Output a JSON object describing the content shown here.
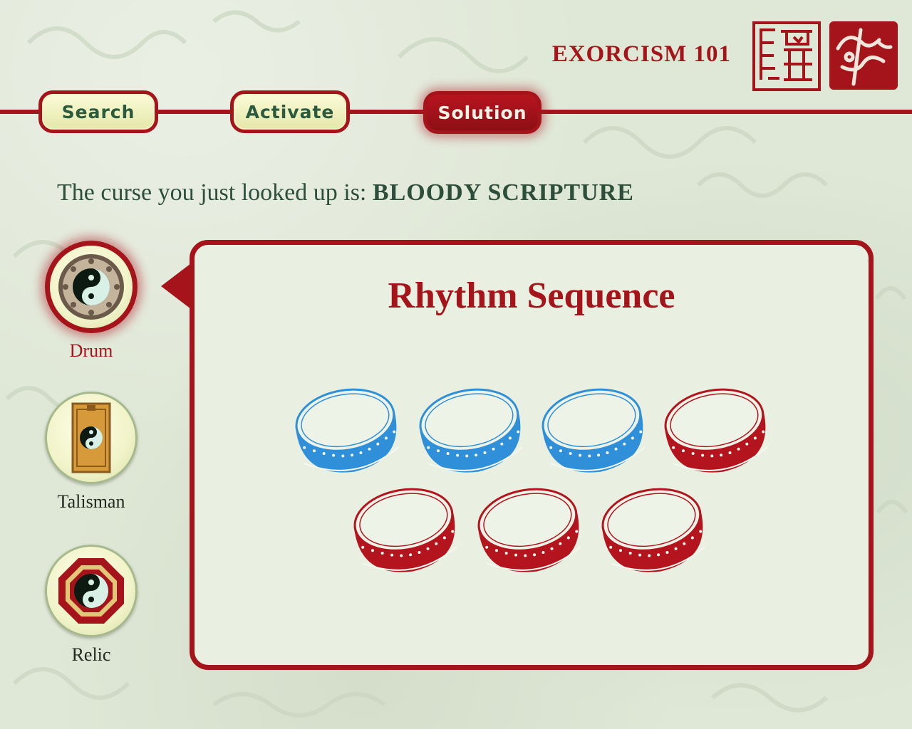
{
  "header": {
    "title": "EXORCISM 101",
    "tabs": [
      {
        "label": "Search",
        "active": false
      },
      {
        "label": "Activate",
        "active": false
      },
      {
        "label": "Solution",
        "active": true
      }
    ]
  },
  "curse": {
    "prefix": "The curse you just looked up is:",
    "name": "BLOODY SCRIPTURE"
  },
  "items": [
    {
      "label": "Drum",
      "icon": "drum-icon",
      "selected": true
    },
    {
      "label": "Talisman",
      "icon": "talisman-icon",
      "selected": false
    },
    {
      "label": "Relic",
      "icon": "relic-icon",
      "selected": false
    }
  ],
  "panel": {
    "title": "Rhythm Sequence",
    "sequence": [
      "blue",
      "blue",
      "blue",
      "red",
      "red",
      "red",
      "red"
    ]
  },
  "colors": {
    "accent_red": "#a5141b",
    "drum_blue": "#2f8fd8",
    "drum_red": "#b3141e",
    "text_green": "#2d4e3a"
  }
}
